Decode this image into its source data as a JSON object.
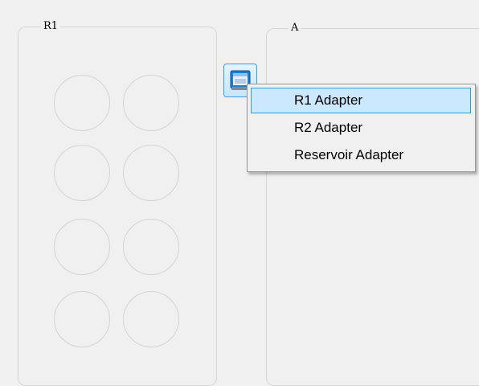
{
  "groups": {
    "r1": {
      "title": "R1"
    },
    "a": {
      "title": "A"
    }
  },
  "adapter_button": {
    "icon": "adapter-icon"
  },
  "context_menu": {
    "items": [
      {
        "label": "R1 Adapter",
        "highlighted": true
      },
      {
        "label": "R2 Adapter",
        "highlighted": false
      },
      {
        "label": "Reservoir Adapter",
        "highlighted": false
      }
    ]
  },
  "colors": {
    "background": "#f0f0f0",
    "menu_highlight": "#cce8ff",
    "menu_highlight_border": "#26a0da",
    "button_border": "#3c9be0"
  }
}
